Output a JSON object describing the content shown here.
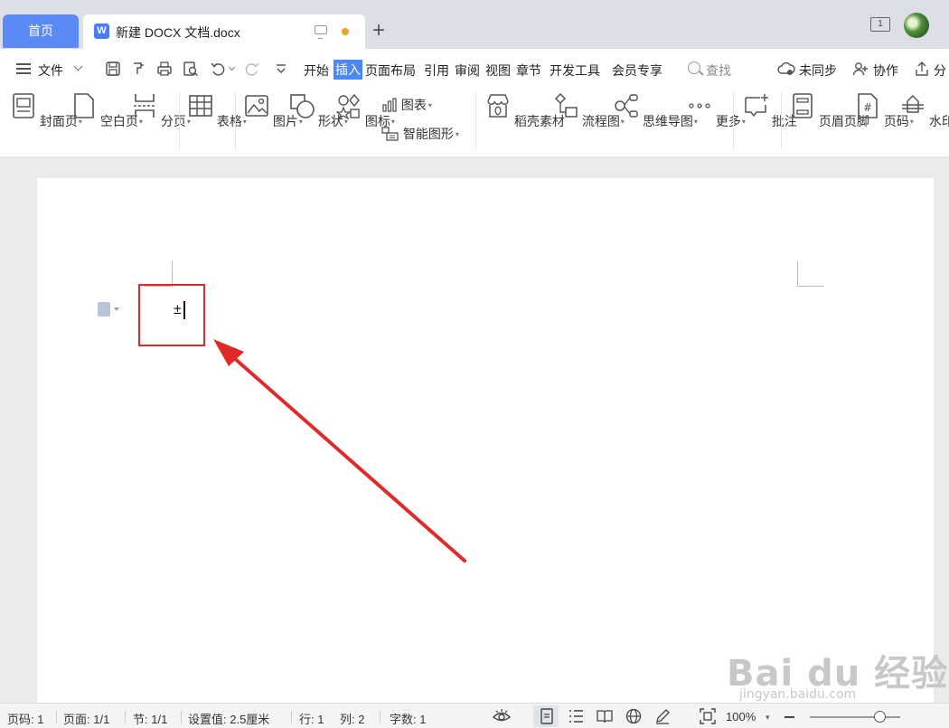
{
  "tabs": {
    "home": "首页",
    "document_title": "新建 DOCX 文档.docx",
    "doc_icon_letter": "W",
    "window_count": "1"
  },
  "menu": {
    "file": "文件",
    "items": [
      "开始",
      "插入",
      "页面布局",
      "引用",
      "审阅",
      "视图",
      "章节",
      "开发工具",
      "会员专享"
    ],
    "active": "插入",
    "search": "查找",
    "sync": "未同步",
    "collab": "协作",
    "share": "分"
  },
  "ribbon": {
    "cover": "封面页",
    "blank": "空白页",
    "page_break": "分页",
    "table": "表格",
    "picture": "图片",
    "shape": "形状",
    "icon": "图标",
    "chart": "图表",
    "smart_graphic": "智能图形",
    "material": "稻壳素材",
    "flowchart": "流程图",
    "mindmap": "思维导图",
    "more": "更多",
    "comment": "批注",
    "header_footer": "页眉页脚",
    "page_number": "页码",
    "watermark": "水印"
  },
  "document": {
    "typed_char": "±"
  },
  "watermark": {
    "text": "Bai du 经验",
    "sub": "jingyan.baidu.com"
  },
  "status": {
    "page_code": "页码: 1",
    "pages": "页面: 1/1",
    "section": "节: 1/1",
    "setting": "设置值: 2.5厘米",
    "row": "行: 1",
    "col": "列: 2",
    "words": "字数: 1",
    "zoom": "100%",
    "zoom_level": 0.77
  },
  "colors": {
    "accent": "#4c87f5",
    "highlight_red": "#e02a2a",
    "modified_dot": "#f0a020"
  }
}
